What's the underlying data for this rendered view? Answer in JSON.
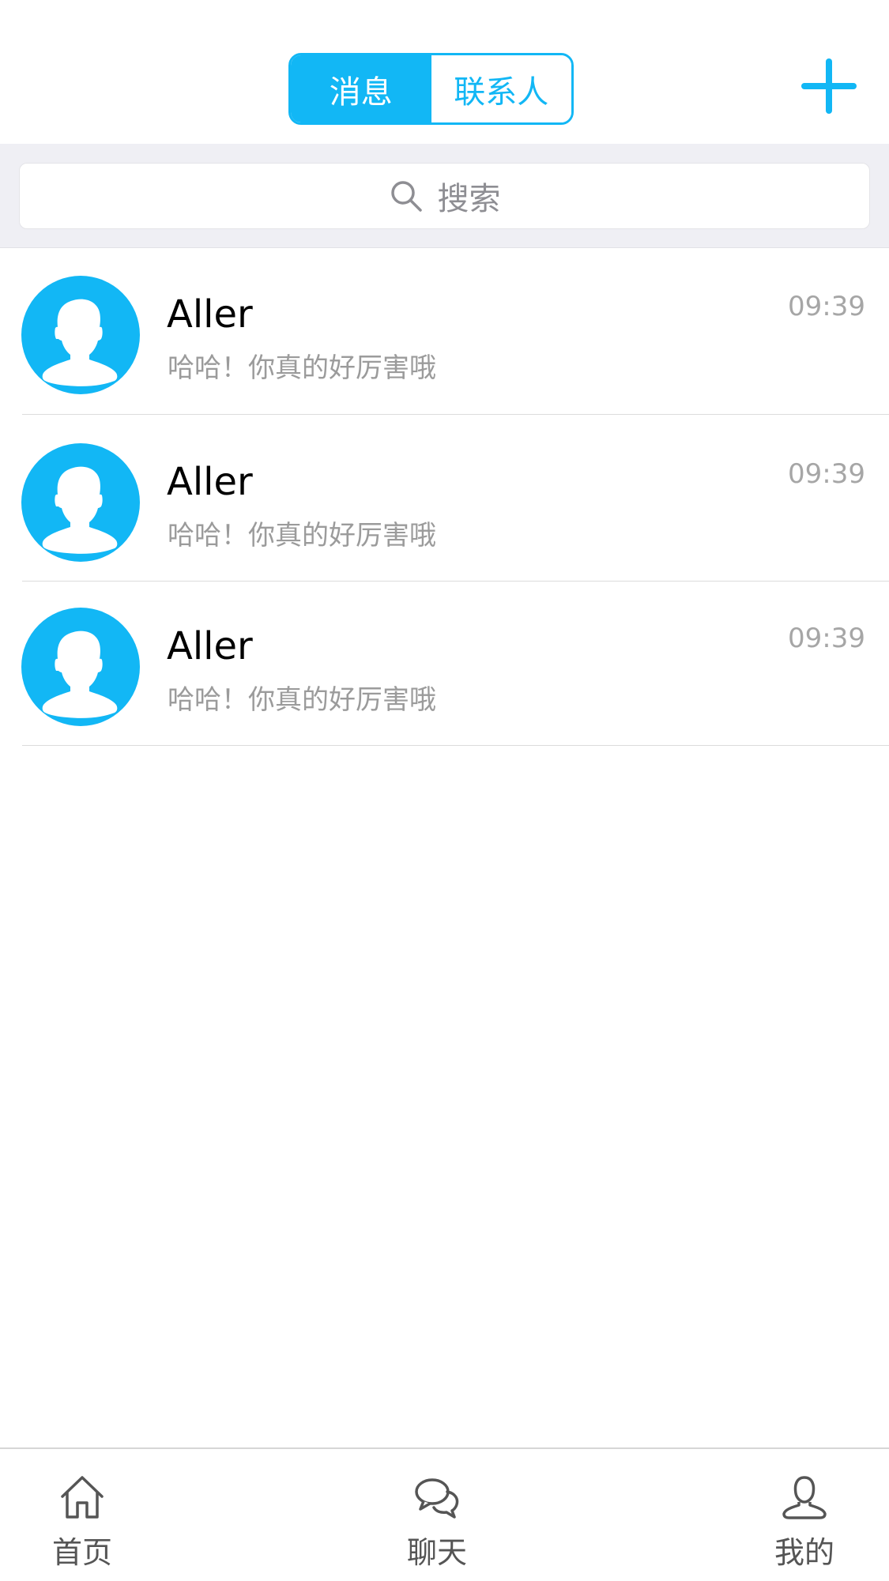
{
  "header": {
    "tabs": [
      {
        "label": "消息",
        "active": true
      },
      {
        "label": "联系人",
        "active": false
      }
    ],
    "add_icon": "plus-icon",
    "accent_color": "#12B7F5"
  },
  "search": {
    "placeholder": "搜索",
    "icon": "search-icon"
  },
  "conversations": [
    {
      "name": "Aller",
      "preview": "哈哈！你真的好厉害哦",
      "time": "09:39",
      "avatar_icon": "user-avatar-icon"
    },
    {
      "name": "Aller",
      "preview": "哈哈！你真的好厉害哦",
      "time": "09:39",
      "avatar_icon": "user-avatar-icon"
    },
    {
      "name": "Aller",
      "preview": "哈哈！你真的好厉害哦",
      "time": "09:39",
      "avatar_icon": "user-avatar-icon"
    }
  ],
  "tabbar": {
    "items": [
      {
        "label": "首页",
        "icon": "home-icon"
      },
      {
        "label": "聊天",
        "icon": "chat-icon"
      },
      {
        "label": "我的",
        "icon": "profile-icon"
      }
    ]
  }
}
